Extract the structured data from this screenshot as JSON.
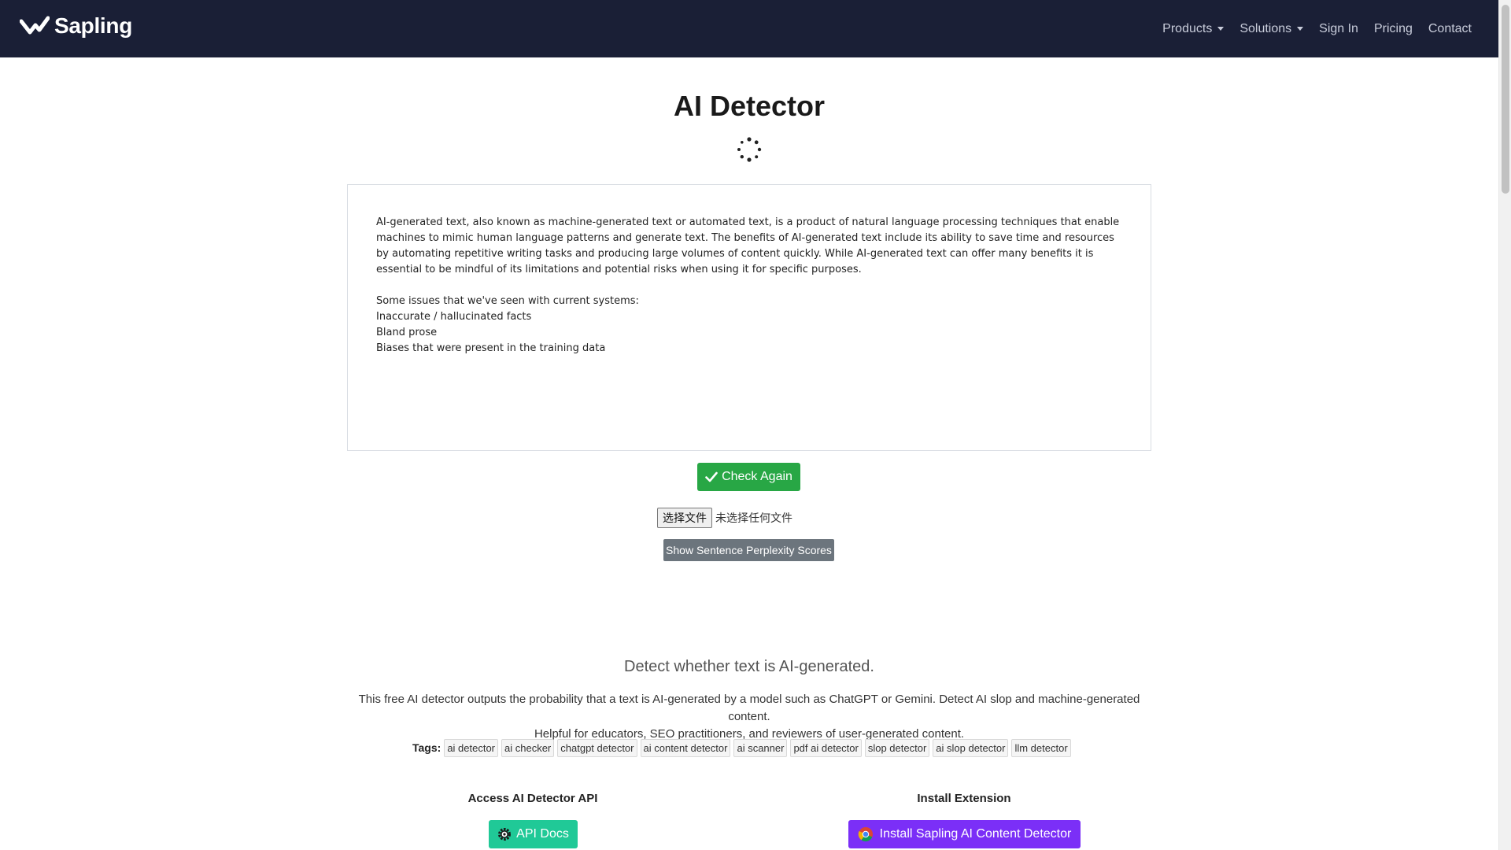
{
  "nav": {
    "brand": "Sapling",
    "items": [
      {
        "label": "Products",
        "dropdown": true
      },
      {
        "label": "Solutions",
        "dropdown": true
      },
      {
        "label": "Sign In",
        "dropdown": false
      },
      {
        "label": "Pricing",
        "dropdown": false
      },
      {
        "label": "Contact",
        "dropdown": false
      }
    ]
  },
  "main": {
    "title": "AI Detector",
    "editor": {
      "paragraphs": [
        "AI-generated text, also known as machine-generated text or automated text, is a product of natural language processing techniques that enable machines to mimic human language patterns and generate text. The benefits of AI-generated text include its ability to save time and resources by automating repetitive writing tasks and producing large volumes of content quickly. While AI-generated text can offer many benefits it is essential to be mindful of its limitations and potential risks when using it for specific purposes.",
        "",
        "Some issues that we've seen with current systems:",
        "Inaccurate / hallucinated facts",
        "Bland prose",
        "Biases that were present in the training data"
      ]
    },
    "check_button": "Check Again",
    "file_button": "选择文件",
    "file_status": "未选择任何文件",
    "perplexity_button": "Show Sentence Perplexity Scores",
    "subtitle": "Detect whether text is AI-generated.",
    "description_line1": "This free AI detector outputs the probability that a text is AI-generated by a model such as ChatGPT or Gemini. Detect AI slop and machine-generated content.",
    "description_line2": "Helpful for educators, SEO practitioners, and reviewers of user-generated content.",
    "tags_label": "Tags:",
    "tags": [
      "ai detector",
      "ai checker",
      "chatgpt detector",
      "ai content detector",
      "ai scanner",
      "pdf ai detector",
      "slop detector",
      "ai slop detector",
      "llm detector"
    ],
    "api_heading": "Access AI Detector API",
    "api_button": "API Docs",
    "extension_heading": "Install Extension",
    "extension_button": "Install Sapling AI Content Detector"
  },
  "colors": {
    "navbar": "#1a1f36",
    "check_button": "#28a745",
    "perplexity_button": "#6c757d",
    "api_button": "#20c997",
    "extension_button": "#7b2ff7"
  }
}
